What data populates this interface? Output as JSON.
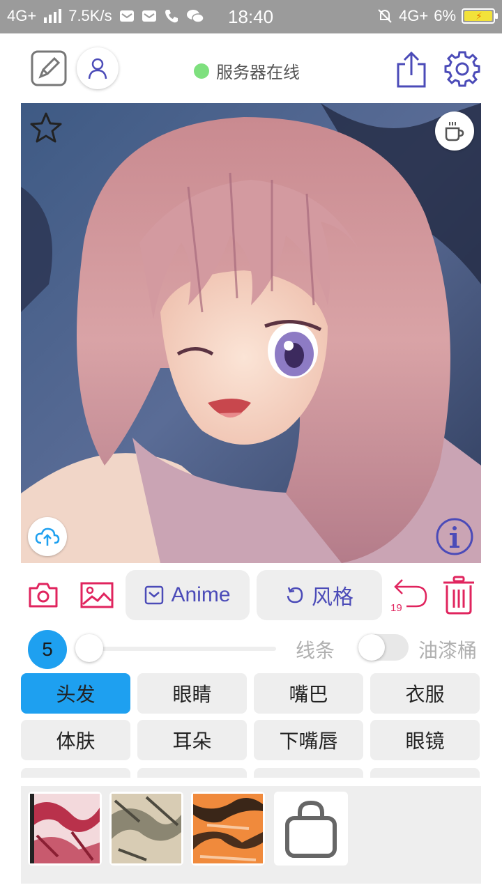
{
  "status_bar": {
    "network": "4G+",
    "speed": "7.5K/s",
    "time": "18:40",
    "network_right": "4G+",
    "battery": "6%"
  },
  "header": {
    "server_status": "服务器在线",
    "server_status_color": "#7ee07e",
    "accent": "#4b4bb8"
  },
  "canvas": {
    "image_icon_names": [
      "star-icon",
      "coffee-icon",
      "upload-cloud-icon",
      "info-icon"
    ]
  },
  "toolbar": {
    "anime_label": "Anime",
    "style_label": "风格",
    "undo_count": "19",
    "primary_red": "#e0245e"
  },
  "brush": {
    "size": "5",
    "lines_label": "线条",
    "bucket_label": "油漆桶"
  },
  "parts": {
    "items": [
      {
        "label": "头发"
      },
      {
        "label": "眼睛"
      },
      {
        "label": "嘴巴"
      },
      {
        "label": "衣服"
      },
      {
        "label": "体肤"
      },
      {
        "label": "耳朵"
      },
      {
        "label": "下嘴唇"
      },
      {
        "label": "眼镜"
      }
    ],
    "active_color": "#1ea0f0"
  }
}
